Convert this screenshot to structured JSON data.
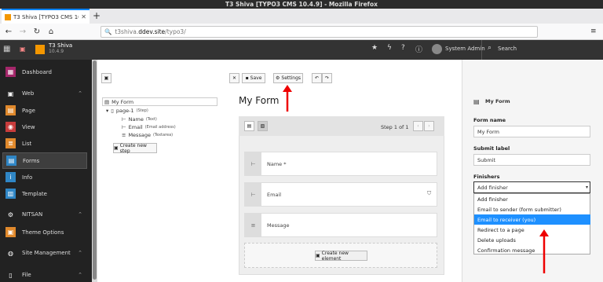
{
  "window": {
    "title": "T3 Shiva [TYPO3 CMS 10.4.9] - Mozilla Firefox"
  },
  "browser": {
    "tab_title": "T3 Shiva [TYPO3 CMS 10.",
    "url_prefix": "t3shiva.",
    "url_domain": "ddev.site",
    "url_path": "/typo3/"
  },
  "topbar": {
    "site_name": "T3 Shiva",
    "version": "10.4.9",
    "user": "System Admin",
    "search": "Search"
  },
  "sidebar": {
    "dashboard": "Dashboard",
    "group_web": "Web",
    "items": [
      "Page",
      "View",
      "List",
      "Forms",
      "Info",
      "Template"
    ],
    "group_nitsan": "NITSAN",
    "theme_options": "Theme Options",
    "group_site": "Site Management",
    "group_file": "File",
    "colors": {
      "dashboard": "#a4276a",
      "page": "#e0892c",
      "view": "#c83c3c",
      "list": "#e0892c",
      "forms": "#2f86c5",
      "info": "#2f86c5",
      "template": "#2f86c5",
      "theme": "#e0892c"
    }
  },
  "toolbar": {
    "save": "Save",
    "settings": "Settings"
  },
  "tree": {
    "root": "My Form",
    "page": "page-1",
    "page_type": "(Step)",
    "fields": [
      {
        "name": "Name",
        "type": "(Text)"
      },
      {
        "name": "Email",
        "type": "(Email address)"
      },
      {
        "name": "Message",
        "type": "(Textarea)"
      }
    ],
    "create_step": "Create new step"
  },
  "stage": {
    "title": "My Form",
    "step": "Step 1 of 1",
    "fields": [
      "Name *",
      "Email",
      "Message"
    ],
    "create_element": "Create new element"
  },
  "inspector": {
    "header": "My Form",
    "form_name_label": "Form name",
    "form_name_value": "My Form",
    "submit_label": "Submit label",
    "submit_value": "Submit",
    "finishers_label": "Finishers",
    "finisher_select": "Add finisher",
    "options": [
      "Add finisher",
      "Email to sender (form submitter)",
      "Email to receiver (you)",
      "Redirect to a page",
      "Delete uploads",
      "Confirmation message"
    ],
    "selected_index": 2
  }
}
